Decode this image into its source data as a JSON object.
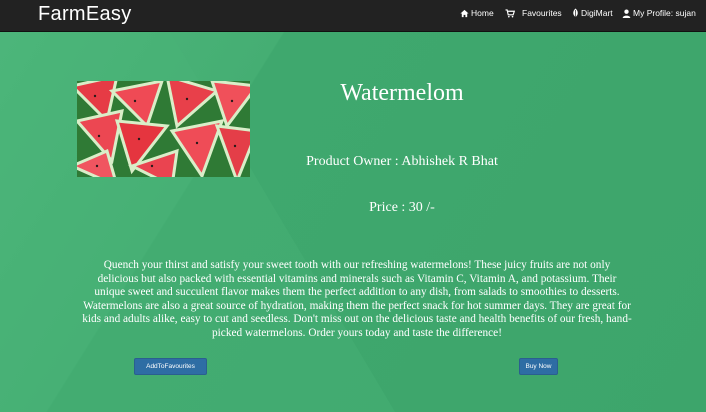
{
  "navbar": {
    "brand": "FarmEasy",
    "items": [
      {
        "label": "Home",
        "icon": "home-icon"
      },
      {
        "label": "Favourites",
        "icon": "cart-icon"
      },
      {
        "label": "DigiMart",
        "icon": "leaf-icon"
      },
      {
        "label": "My Profile: sujan",
        "icon": "user-icon"
      }
    ]
  },
  "product": {
    "name": "Watermelom",
    "owner": "Product Owner : Abhishek R Bhat",
    "price": "Price : 30 /-",
    "description": "Quench your thirst and satisfy your sweet tooth with our refreshing watermelons! These juicy fruits are not only delicious but also packed with essential vitamins and minerals such as Vitamin C, Vitamin A, and potassium. Their unique sweet and succulent flavor makes them the perfect addition to any dish, from salads to smoothies to desserts. Watermelons are also a great source of hydration, making them the perfect snack for hot summer days. They are great for kids and adults alike, easy to cut and seedless. Don't miss out on the delicious taste and health benefits of our fresh, hand-picked watermelons. Order yours today and taste the difference!"
  },
  "actions": {
    "add_to_favourites": "AddToFavourites",
    "buy_now": "Buy Now"
  },
  "colors": {
    "navbar": "#222222",
    "background": "#3da56b",
    "button": "#2e6da4"
  }
}
